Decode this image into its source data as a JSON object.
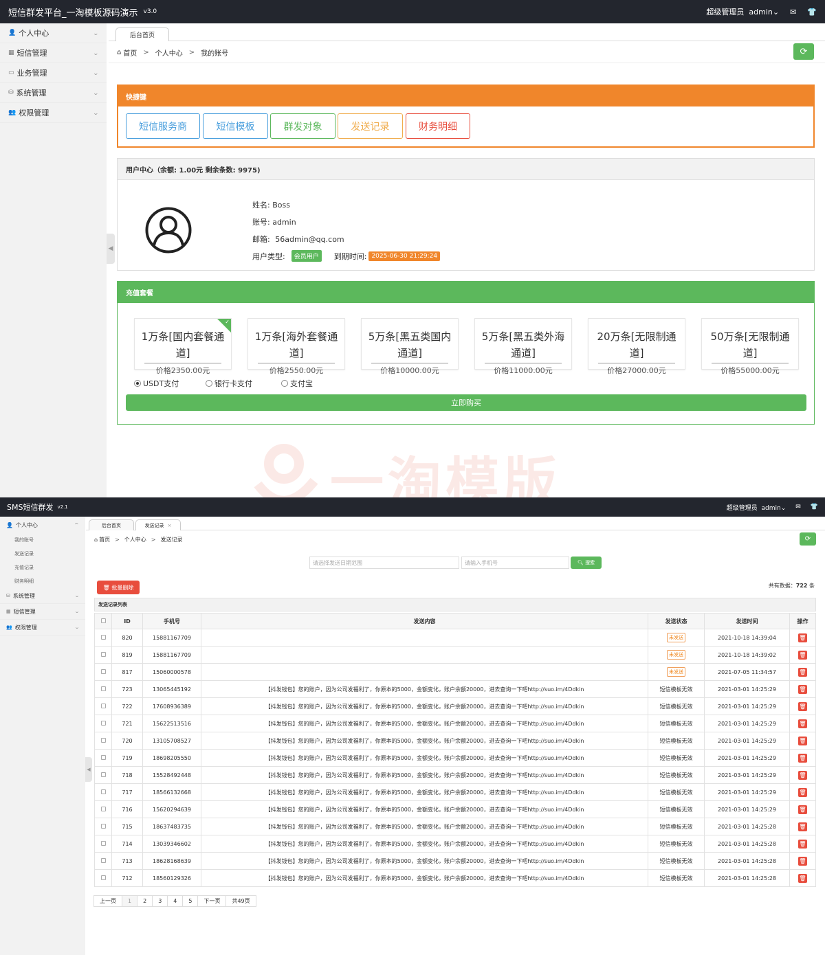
{
  "s1": {
    "header": {
      "title": "短信群发平台_一淘模板源码演示",
      "version": "v3.0",
      "user_role": "超级管理员",
      "user_name": "admin",
      "mail_icon": "mail-icon",
      "shirt_icon": "shirt-icon"
    },
    "sidebar": [
      {
        "label": "个人中心",
        "icon": "user-icon"
      },
      {
        "label": "短信管理",
        "icon": "sms-icon"
      },
      {
        "label": "业务管理",
        "icon": "business-icon"
      },
      {
        "label": "系统管理",
        "icon": "system-icon"
      },
      {
        "label": "权限管理",
        "icon": "permission-icon"
      }
    ],
    "tabs": [
      "后台首页"
    ],
    "breadcrumb": [
      "首页",
      "个人中心",
      "我的账号"
    ],
    "quick": {
      "title": "快捷键",
      "buttons": [
        {
          "label": "短信服务商",
          "color": "#4a9fdd"
        },
        {
          "label": "短信模板",
          "color": "#4a9fdd"
        },
        {
          "label": "群发对象",
          "color": "#5cb85c"
        },
        {
          "label": "发送记录",
          "color": "#f0ad4e"
        },
        {
          "label": "财务明细",
          "color": "#e84d3d"
        }
      ]
    },
    "user": {
      "title": "用户中心（余额: 1.00元 剩余条数: 9975)",
      "name": "姓名: Boss",
      "account": "账号: admin",
      "email_label": "邮箱:",
      "email": "56admin@qq.com",
      "type_label": "用户类型:",
      "type": "会员用户",
      "expire_label": "到期时间:",
      "expire": "2025-06-30 21:29:24"
    },
    "recharge": {
      "title": "充值套餐",
      "packages": [
        {
          "name": "1万条[国内套餐通道]",
          "price": "价格2350.00元",
          "selected": true
        },
        {
          "name": "1万条[海外套餐通道]",
          "price": "价格2550.00元"
        },
        {
          "name": "5万条[黑五类国内通道]",
          "price": "价格10000.00元"
        },
        {
          "name": "5万条[黑五类外海通道]",
          "price": "价格11000.00元"
        },
        {
          "name": "20万条[无限制通道]",
          "price": "价格27000.00元"
        },
        {
          "name": "50万条[无限制通道]",
          "price": "价格55000.00元"
        }
      ],
      "payments": [
        {
          "label": "USDT支付",
          "checked": true
        },
        {
          "label": "银行卡支付",
          "checked": false
        },
        {
          "label": "支付宝",
          "checked": false
        }
      ],
      "buy": "立即购买"
    },
    "watermark": "一淘模版"
  },
  "s2": {
    "header": {
      "title": "SMS短信群发",
      "version": "v2.1",
      "user_role": "超级管理员",
      "user_name": "admin"
    },
    "sidebar": {
      "group": "个人中心",
      "subs": [
        "我的账号",
        "发送记录",
        "充值记录",
        "财务明细"
      ],
      "others": [
        "系统管理",
        "短信管理",
        "权限管理"
      ]
    },
    "tabs": [
      "后台首页",
      "发送记录"
    ],
    "breadcrumb": [
      "首页",
      "个人中心",
      "发送记录"
    ],
    "search": {
      "date_placeholder": "请选择发送日期范围",
      "phone_placeholder": "请输入手机号",
      "button": "搜索"
    },
    "batch_delete": "批量删除",
    "total_label": "共有数据：",
    "total": "722",
    "total_unit": "条",
    "list_title": "发送记录列表",
    "columns": [
      "ID",
      "手机号",
      "发送内容",
      "发送状态",
      "发送时间",
      "操作"
    ],
    "rows": [
      {
        "id": "820",
        "phone": "15881167709",
        "content": "",
        "status": "未发送",
        "time": "2021-10-18 14:39:04"
      },
      {
        "id": "819",
        "phone": "15881167709",
        "content": "",
        "status": "未发送",
        "time": "2021-10-18 14:39:02"
      },
      {
        "id": "817",
        "phone": "15060000578",
        "content": "",
        "status": "未发送",
        "time": "2021-07-05 11:34:57"
      },
      {
        "id": "723",
        "phone": "13065445192",
        "content": "【抖发钱包】您的账户，因为公司发福利了，你原本的5000，金额变化，账户余额20000，进去查询一下吧http://suo.im/4Ddkin",
        "status": "短信模板无效",
        "time": "2021-03-01 14:25:29"
      },
      {
        "id": "722",
        "phone": "17608936389",
        "content": "【抖发钱包】您的账户，因为公司发福利了，你原本的5000，金额变化，账户余额20000，进去查询一下吧http://suo.im/4Ddkin",
        "status": "短信模板无效",
        "time": "2021-03-01 14:25:29"
      },
      {
        "id": "721",
        "phone": "15622513516",
        "content": "【抖发钱包】您的账户，因为公司发福利了，你原本的5000，金额变化，账户余额20000，进去查询一下吧http://suo.im/4Ddkin",
        "status": "短信模板无效",
        "time": "2021-03-01 14:25:29"
      },
      {
        "id": "720",
        "phone": "13105708527",
        "content": "【抖发钱包】您的账户，因为公司发福利了，你原本的5000，金额变化，账户余额20000，进去查询一下吧http://suo.im/4Ddkin",
        "status": "短信模板无效",
        "time": "2021-03-01 14:25:29"
      },
      {
        "id": "719",
        "phone": "18698205550",
        "content": "【抖发钱包】您的账户，因为公司发福利了，你原本的5000，金额变化，账户余额20000，进去查询一下吧http://suo.im/4Ddkin",
        "status": "短信模板无效",
        "time": "2021-03-01 14:25:29"
      },
      {
        "id": "718",
        "phone": "15528492448",
        "content": "【抖发钱包】您的账户，因为公司发福利了，你原本的5000，金额变化，账户余额20000，进去查询一下吧http://suo.im/4Ddkin",
        "status": "短信模板无效",
        "time": "2021-03-01 14:25:29"
      },
      {
        "id": "717",
        "phone": "18566132668",
        "content": "【抖发钱包】您的账户，因为公司发福利了，你原本的5000，金额变化，账户余额20000，进去查询一下吧http://suo.im/4Ddkin",
        "status": "短信模板无效",
        "time": "2021-03-01 14:25:29"
      },
      {
        "id": "716",
        "phone": "15620294639",
        "content": "【抖发钱包】您的账户，因为公司发福利了，你原本的5000，金额变化，账户余额20000，进去查询一下吧http://suo.im/4Ddkin",
        "status": "短信模板无效",
        "time": "2021-03-01 14:25:29"
      },
      {
        "id": "715",
        "phone": "18637483735",
        "content": "【抖发钱包】您的账户，因为公司发福利了，你原本的5000，金额变化，账户余额20000，进去查询一下吧http://suo.im/4Ddkin",
        "status": "短信模板无效",
        "time": "2021-03-01 14:25:28"
      },
      {
        "id": "714",
        "phone": "13039346602",
        "content": "【抖发钱包】您的账户，因为公司发福利了，你原本的5000，金额变化，账户余额20000，进去查询一下吧http://suo.im/4Ddkin",
        "status": "短信模板无效",
        "time": "2021-03-01 14:25:28"
      },
      {
        "id": "713",
        "phone": "18628168639",
        "content": "【抖发钱包】您的账户，因为公司发福利了，你原本的5000，金额变化，账户余额20000，进去查询一下吧http://suo.im/4Ddkin",
        "status": "短信模板无效",
        "time": "2021-03-01 14:25:28"
      },
      {
        "id": "712",
        "phone": "18560129326",
        "content": "【抖发钱包】您的账户，因为公司发福利了，你原本的5000，金额变化，账户余额20000，进去查询一下吧http://suo.im/4Ddkin",
        "status": "短信模板无效",
        "time": "2021-03-01 14:25:28"
      }
    ],
    "pager": [
      "上一页",
      "1",
      "2",
      "3",
      "4",
      "5",
      "下一页",
      "共49页"
    ]
  }
}
